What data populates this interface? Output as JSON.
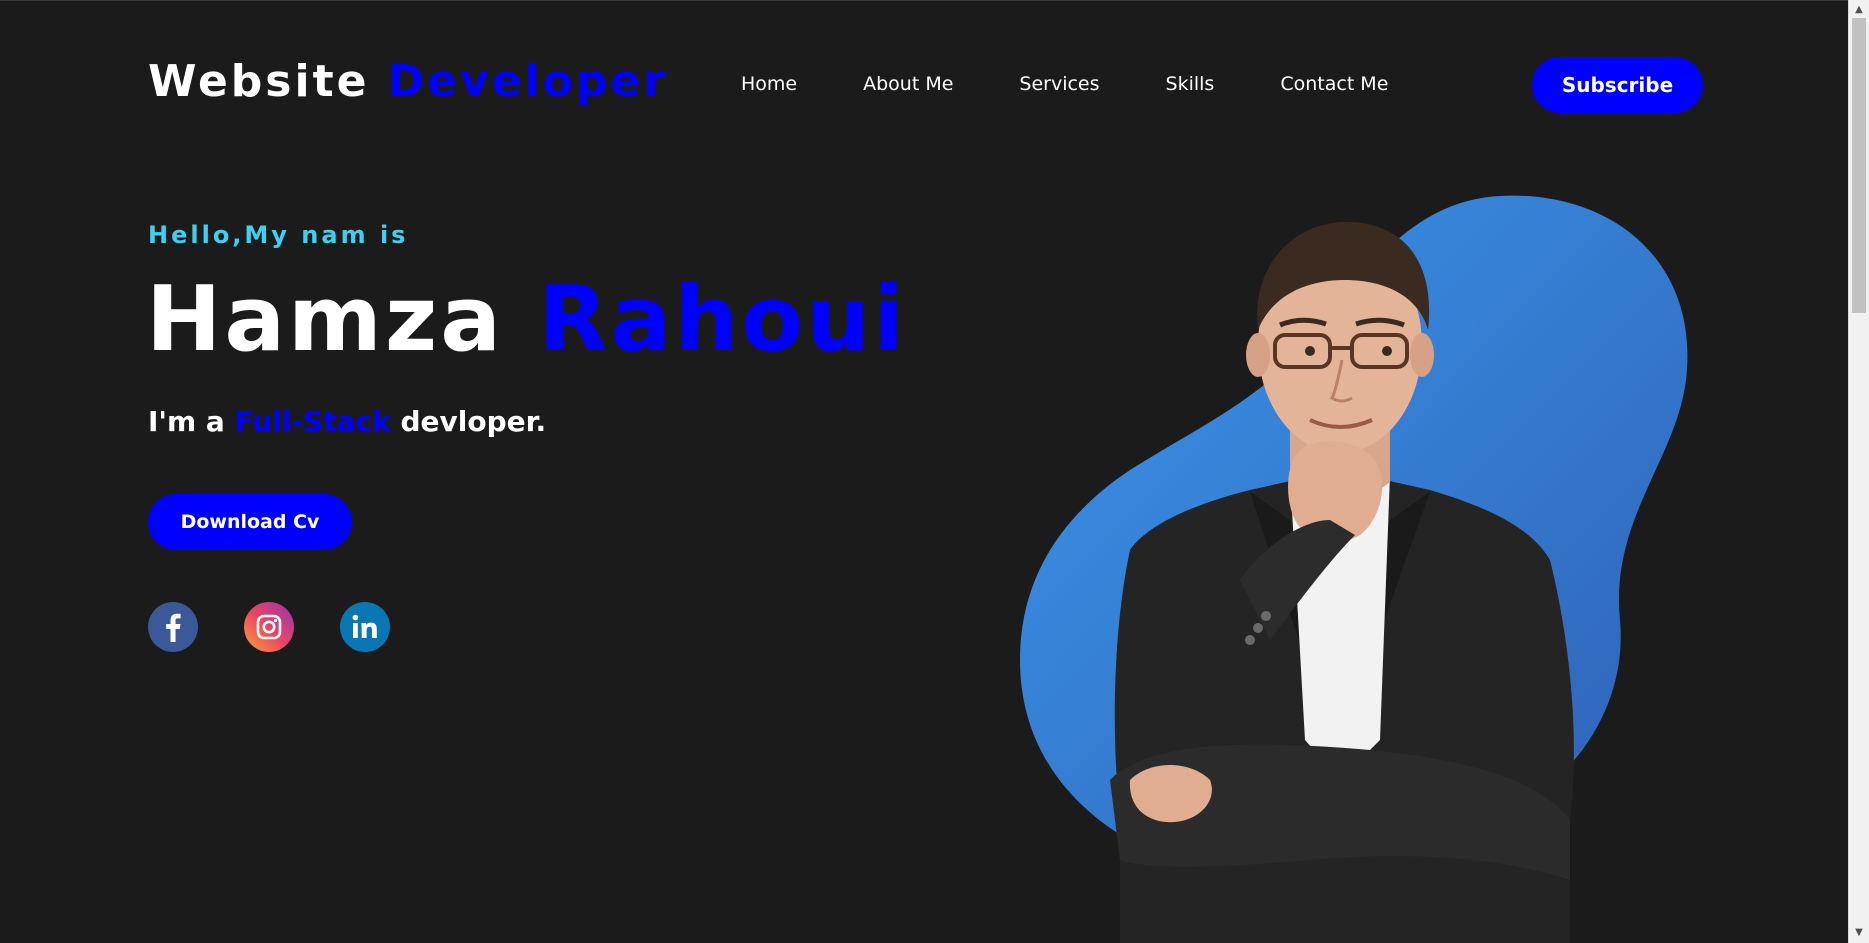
{
  "header": {
    "logo_part1": "Website",
    "logo_part2": "Developer",
    "nav": [
      "Home",
      "About Me",
      "Services",
      "Skills",
      "Contact Me"
    ],
    "subscribe_label": "Subscribe"
  },
  "hero": {
    "greeting": "Hello,My nam is",
    "first_name": "Hamza",
    "last_name": "Rahoui",
    "tagline_prefix": "I'm a",
    "tagline_accent": "Full-Stack",
    "tagline_suffix": "devloper.",
    "download_label": "Download Cv"
  },
  "socials": [
    {
      "name": "facebook",
      "icon": "facebook-icon"
    },
    {
      "name": "instagram",
      "icon": "instagram-icon"
    },
    {
      "name": "linkedin",
      "icon": "linkedin-icon"
    }
  ],
  "colors": {
    "background": "#1b1b1b",
    "accent": "#0000ff",
    "greeting": "#3fd0f0",
    "blob": "#2f80d8"
  },
  "scrollbar": {
    "up_icon": "chevron-up-icon",
    "down_icon": "chevron-down-icon"
  }
}
